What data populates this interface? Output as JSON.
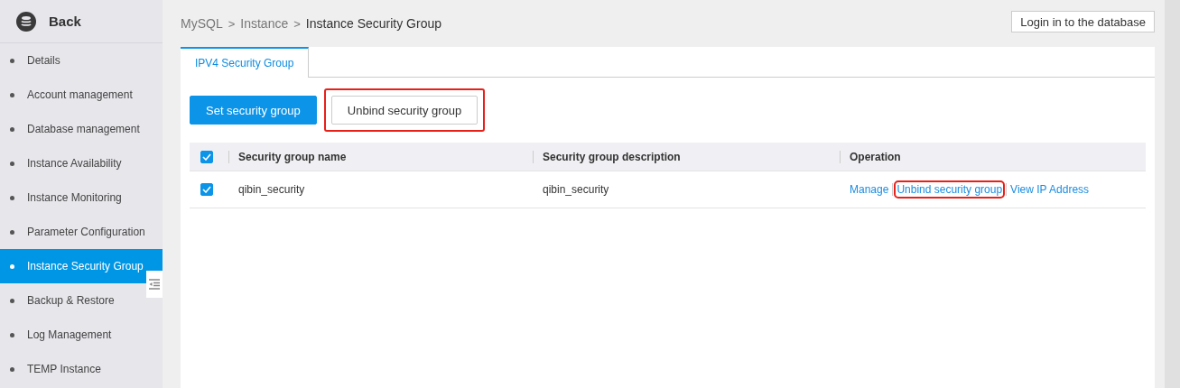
{
  "sidebar": {
    "back_label": "Back",
    "items": [
      {
        "label": "Details",
        "selected": false
      },
      {
        "label": "Account management",
        "selected": false
      },
      {
        "label": "Database management",
        "selected": false
      },
      {
        "label": "Instance Availability",
        "selected": false
      },
      {
        "label": "Instance Monitoring",
        "selected": false
      },
      {
        "label": "Parameter Configuration",
        "selected": false
      },
      {
        "label": "Instance Security Group",
        "selected": true
      },
      {
        "label": "Backup & Restore",
        "selected": false
      },
      {
        "label": "Log Management",
        "selected": false
      },
      {
        "label": "TEMP Instance",
        "selected": false
      }
    ]
  },
  "breadcrumb": {
    "items": [
      "MySQL",
      "Instance",
      "Instance Security Group"
    ],
    "separators": [
      ">",
      ">"
    ]
  },
  "login_button": "Login in to the database",
  "tabs": [
    {
      "label": "IPV4 Security Group",
      "selected": true
    }
  ],
  "actions": [
    {
      "label": "Set security group",
      "kind": "primary",
      "highlighted": false
    },
    {
      "label": "Unbind security group",
      "kind": "default",
      "highlighted": true
    }
  ],
  "table": {
    "header_checked": true,
    "columns": [
      "Security group name",
      "Security group description",
      "Operation"
    ],
    "rows": [
      {
        "checked": true,
        "name": "qibin_security",
        "description": "qibin_security",
        "operations": [
          {
            "label": "Manage",
            "highlighted": false
          },
          {
            "label": "Unbind security group",
            "highlighted": true
          },
          {
            "label": "View IP Address",
            "highlighted": false
          }
        ]
      }
    ]
  }
}
